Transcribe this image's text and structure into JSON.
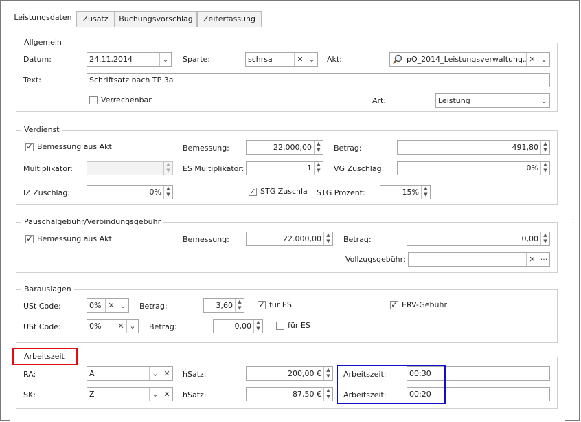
{
  "tabs": [
    "Leistungsdaten",
    "Zusatz",
    "Buchungsvorschlag",
    "Zeiterfassung"
  ],
  "allgemein": {
    "title": "Allgemein",
    "datum_label": "Datum:",
    "datum_value": "24.11.2014",
    "sparte_label": "Sparte:",
    "sparte_value": "schrsa",
    "akt_label": "Akt:",
    "akt_value": "pO_2014_Leistungsverwaltung...",
    "text_label": "Text:",
    "text_value": "Schriftsatz nach TP 3a",
    "verrechenbar_label": "Verrechenbar",
    "verrechenbar_checked": false,
    "art_label": "Art:",
    "art_value": "Leistung"
  },
  "verdienst": {
    "title": "Verdienst",
    "bemessung_aus_akt_label": "Bemessung aus Akt",
    "bemessung_aus_akt_checked": true,
    "bemessung_label": "Bemessung:",
    "bemessung_value": "22.000,00",
    "betrag_label": "Betrag:",
    "betrag_value": "491,80",
    "multiplikator_label": "Multiplikator:",
    "multiplikator_value": "",
    "es_multiplikator_label": "ES Multiplikator:",
    "es_multiplikator_value": "1",
    "vg_zuschlag_label": "VG Zuschlag:",
    "vg_zuschlag_value": "0%",
    "iz_zuschlag_label": "IZ Zuschlag:",
    "iz_zuschlag_value": "0%",
    "stg_zuschlag_label": "STG Zuschla",
    "stg_zuschlag_checked": true,
    "stg_prozent_label": "STG Prozent:",
    "stg_prozent_value": "15%"
  },
  "pauschal": {
    "title": "Pauschalgebühr/Verbindungsgebühr",
    "bemessung_aus_akt_label": "Bemessung aus Akt",
    "bemessung_aus_akt_checked": true,
    "bemessung_label": "Bemessung:",
    "bemessung_value": "22.000,00",
    "betrag_label": "Betrag:",
    "betrag_value": "0,00",
    "vollzug_label": "Vollzugsgebühr:",
    "vollzug_value": ""
  },
  "barauslagen": {
    "title": "Barauslagen",
    "rows": [
      {
        "ust_label": "USt Code:",
        "ust_value": "0%",
        "betrag_label": "Betrag:",
        "betrag_value": "3,60",
        "fuer_es_label": "für ES",
        "fuer_es_checked": true
      },
      {
        "ust_label": "USt Code:",
        "ust_value": "0%",
        "betrag_label": "Betrag:",
        "betrag_value": "0,00",
        "fuer_es_label": "für ES",
        "fuer_es_checked": false
      }
    ],
    "erv_label": "ERV-Gebühr",
    "erv_checked": true
  },
  "arbeitszeit": {
    "title": "Arbeitszeit",
    "rows": [
      {
        "label": "RA:",
        "value": "A",
        "hsatz_label": "hSatz:",
        "hsatz_value": "200,00 €",
        "az_label": "Arbeitszeit:",
        "az_value": "00:30"
      },
      {
        "label": "SK:",
        "value": "Z",
        "hsatz_label": "hSatz:",
        "hsatz_value": "87,50 €",
        "az_label": "Arbeitszeit:",
        "az_value": "00:20"
      }
    ]
  },
  "icons": {
    "dropdown": "chevron-down-icon",
    "clear": "close-icon",
    "search": "search-icon",
    "more": "ellipsis-icon",
    "spin": "spinner-icon",
    "check": "checkmark-icon"
  },
  "colors": {
    "highlight_red": "#e01010",
    "highlight_blue": "#1010c8"
  }
}
